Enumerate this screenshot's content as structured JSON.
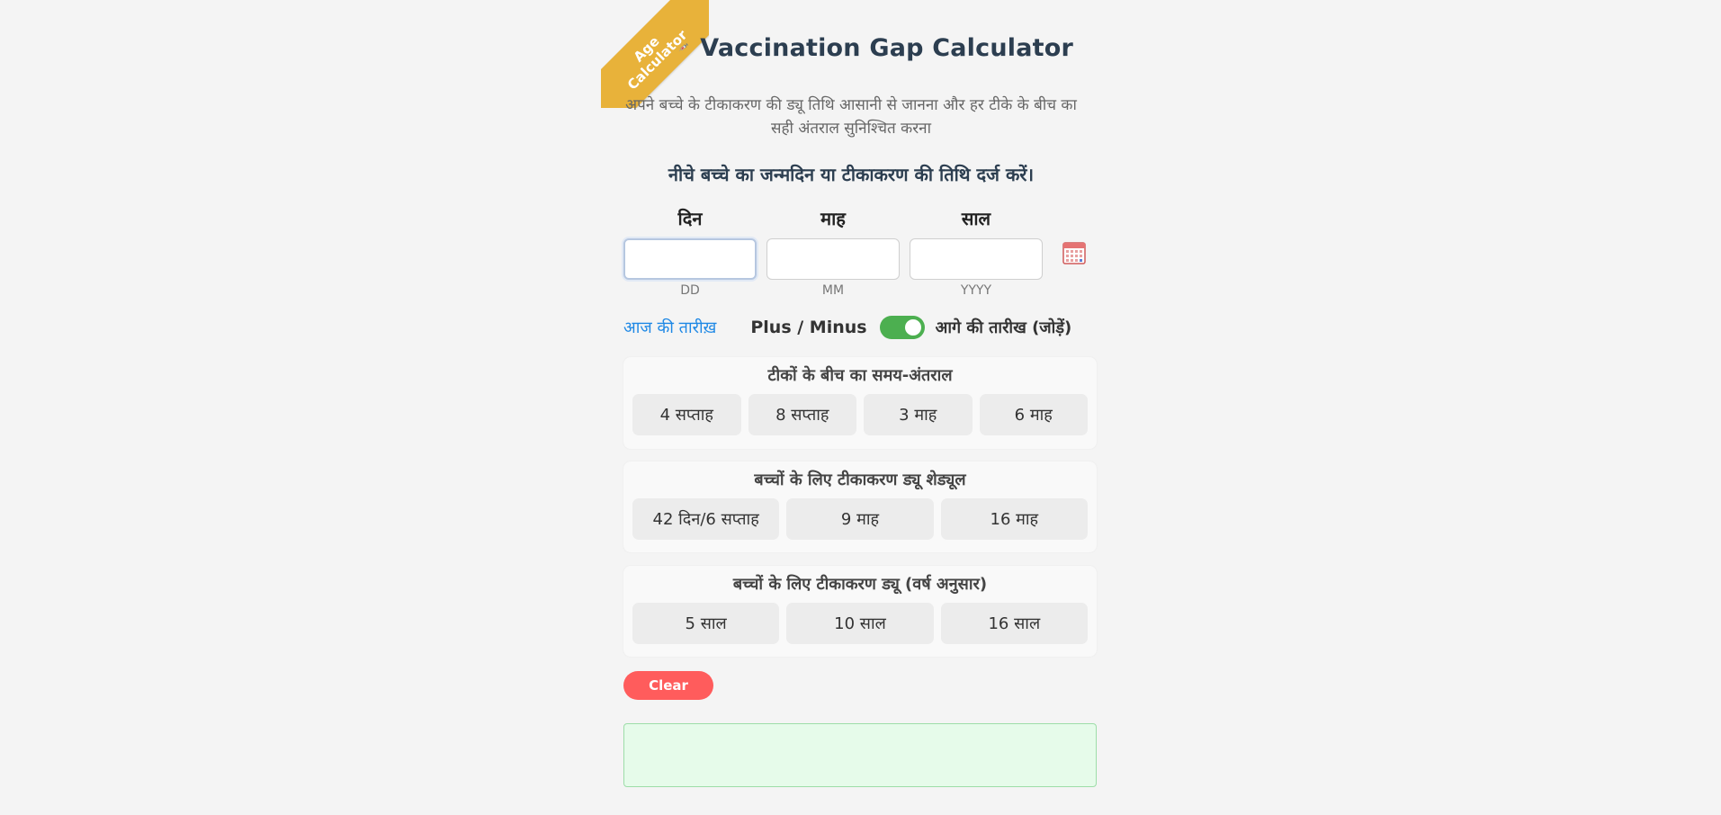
{
  "ribbon": {
    "text": "Age\nCalculator"
  },
  "header": {
    "title": "Vaccination Gap Calculator",
    "subtitle": "अपने बच्चे के टीकाकरण की ड्यू तिथि आसानी से जानना और हर टीके के बीच का सही अंतराल सुनिश्चित करना"
  },
  "instruction": "नीचे बच्चे का जन्मदिन या टीकाकरण की तिथि दर्ज करें।",
  "date_fields": {
    "day": {
      "label": "दिन",
      "value": "",
      "hint": "DD"
    },
    "month": {
      "label": "माह",
      "value": "",
      "hint": "MM"
    },
    "year": {
      "label": "साल",
      "value": "",
      "hint": "YYYY"
    }
  },
  "options": {
    "today_link": "आज की तारीख़",
    "plus_minus_label": "Plus / Minus",
    "toggle_on": true,
    "toggle_label": "आगे की तारीख (जोड़ें)"
  },
  "sections": {
    "gap": {
      "title": "टीकों के बीच का समय-अंतराल",
      "buttons": [
        "4 सप्ताह",
        "8 सप्ताह",
        "3 माह",
        "6 माह"
      ]
    },
    "schedule": {
      "title": "बच्चों के लिए टीकाकरण ड्यू शेड्यूल",
      "buttons": [
        "42 दिन/6 सप्ताह",
        "9 माह",
        "16 माह"
      ]
    },
    "yearly": {
      "title": "बच्चों के लिए टीकाकरण ड्यू (वर्ष अनुसार)",
      "buttons": [
        "5 साल",
        "10 साल",
        "16 साल"
      ]
    }
  },
  "clear_label": "Clear",
  "result": "",
  "colors": {
    "ribbon": "#e8b23a",
    "toggle": "#4caf50",
    "clear": "#ff5c5c",
    "link": "#1e88e5",
    "result_bg": "#e6fbea"
  },
  "icons": {
    "title_icon": "syringe-icon",
    "date_picker": "calendar-icon"
  }
}
